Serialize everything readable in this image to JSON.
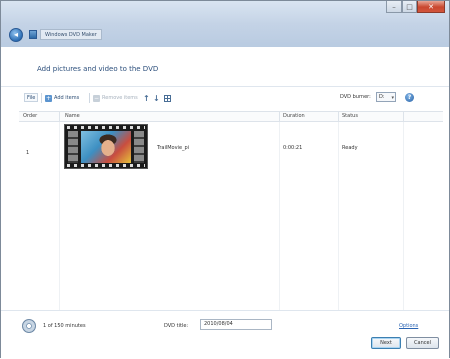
{
  "window": {
    "app_title": "Windows DVD Maker",
    "caption": {
      "minimize": "–",
      "maximize": "□",
      "close": "✕"
    }
  },
  "main": {
    "heading": "Add pictures and video to the DVD"
  },
  "toolbar": {
    "file": "File",
    "add_items": "Add items",
    "remove_items": "Remove items",
    "move_up": "↑",
    "move_down": "↓",
    "burner_label": "DVD burner:",
    "burner_value": "D:"
  },
  "list": {
    "columns": [
      "Order",
      "Name",
      "Duration",
      "Status"
    ],
    "rows": [
      {
        "order": "1",
        "name": "TrailMovie_pi",
        "duration": "0:00:21",
        "status": "Ready"
      }
    ]
  },
  "footer": {
    "minutes": "1 of 150 minutes",
    "title_label": "DVD title:",
    "title_value": "2010/08/04",
    "options": "Options",
    "next": "Next",
    "cancel": "Cancel"
  },
  "colors": {
    "titlebar": "#c4d3e6",
    "heading": "#2c4f7c",
    "link": "#2a64b3",
    "close": "#c9472f"
  }
}
